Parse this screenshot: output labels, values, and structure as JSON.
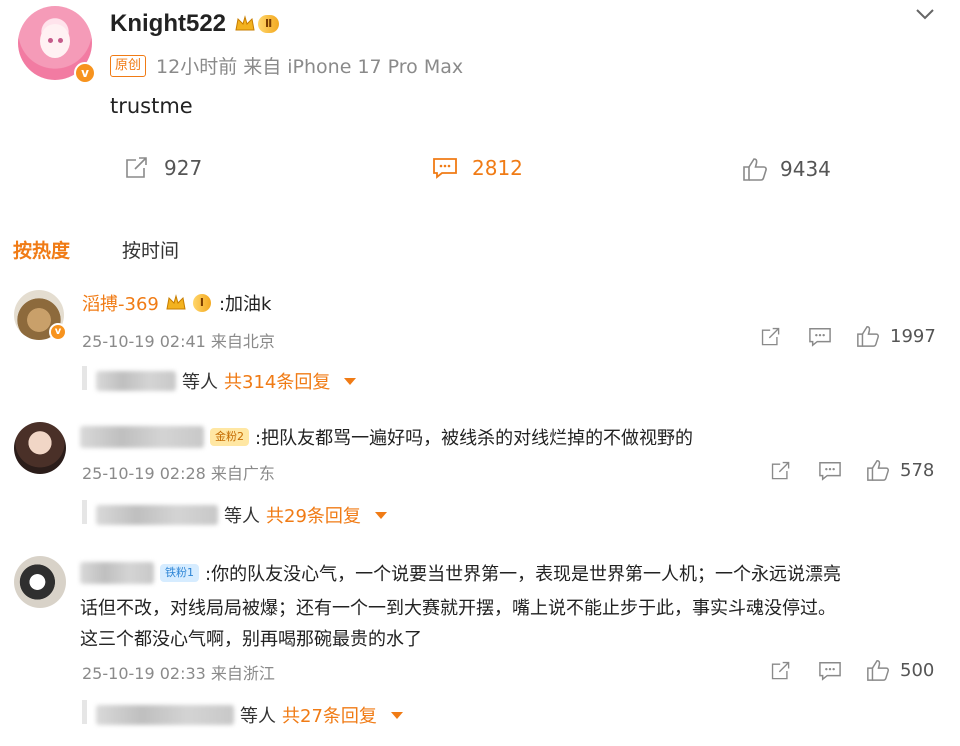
{
  "post": {
    "username": "Knight522",
    "level_badge": "Ⅱ",
    "original_tag": "原创",
    "time_source": "12小时前 来自 iPhone 17 Pro Max",
    "text": "trustme",
    "repost_count": "927",
    "comment_count": "2812",
    "like_count": "9434"
  },
  "sort_tabs": {
    "hot": "按热度",
    "time": "按时间"
  },
  "comments": [
    {
      "username": "滔搏-369",
      "level_badge": "Ⅰ",
      "text": ":加油k",
      "meta": "25-10-19 02:41 来自北京",
      "likes": "1997",
      "replies_suffix": "等人",
      "replies_total": "共314条回复"
    },
    {
      "fan_tag": "金粉2",
      "text": ":把队友都骂一遍好吗，被线杀的对线烂掉的不做视野的",
      "meta": "25-10-19 02:28 来自广东",
      "likes": "578",
      "replies_suffix": "等人",
      "replies_total": "共29条回复"
    },
    {
      "fan_tag": "铁粉1",
      "text_line1": ":你的队友没心气，一个说要当世界第一，表现是世界第一人机；一个永远说漂亮",
      "text_line2": "话但不改，对线局局被爆；还有一个一到大赛就开摆，嘴上说不能止步于此，事实斗魂没停过。",
      "text_line3": "这三个都没心气啊，别再喝那碗最贵的水了",
      "meta": "25-10-19 02:33 来自浙江",
      "likes": "500",
      "replies_suffix": "等人",
      "replies_total": "共27条回复"
    }
  ]
}
